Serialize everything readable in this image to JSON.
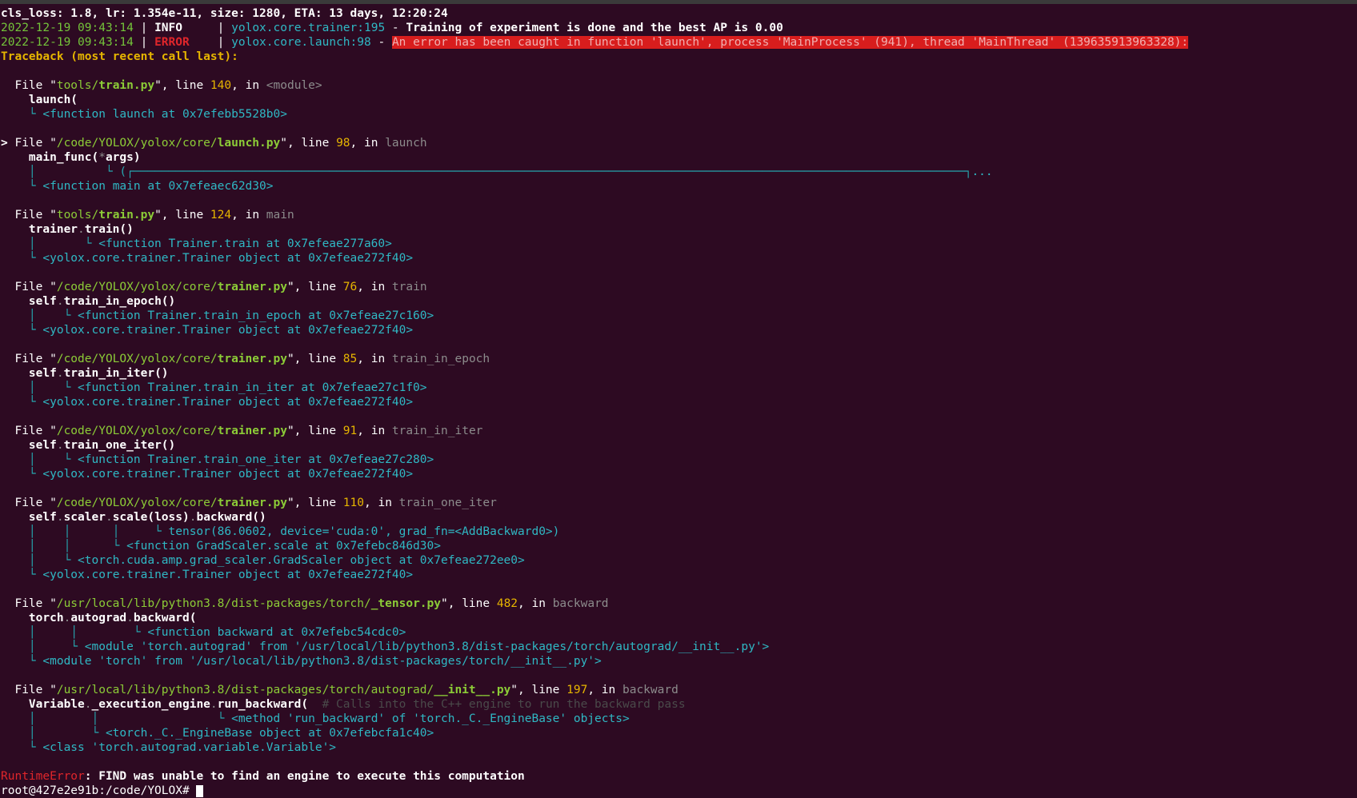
{
  "terminal": {
    "lines": [
      [
        {
          "t": "cls_loss: 1.8, lr: 1.354e-11, size: 1280, ETA: 13 days, 12:20:24",
          "c": "w b"
        }
      ],
      [
        {
          "t": "2022-12-19 09:43:14",
          "c": "ok"
        },
        {
          "t": " | ",
          "c": "w"
        },
        {
          "t": "INFO    ",
          "c": "w b"
        },
        {
          "t": " | ",
          "c": "w"
        },
        {
          "t": "yolox.core.trainer",
          "c": "c"
        },
        {
          "t": ":195",
          "c": "c"
        },
        {
          "t": " - ",
          "c": "w"
        },
        {
          "t": "Training of experiment is done and the best AP is 0.00",
          "c": "w b"
        }
      ],
      [
        {
          "t": "2022-12-19 09:43:14",
          "c": "ok"
        },
        {
          "t": " | ",
          "c": "w"
        },
        {
          "t": "ERROR   ",
          "c": "r b"
        },
        {
          "t": " | ",
          "c": "w"
        },
        {
          "t": "yolox.core.launch",
          "c": "c"
        },
        {
          "t": ":98",
          "c": "c"
        },
        {
          "t": " - ",
          "c": "w"
        },
        {
          "t": "An error has been caught in function 'launch', process 'MainProcess' (941), thread 'MainThread' (139635913963328):",
          "c": "hl"
        }
      ],
      [
        {
          "t": "Traceback (most recent call last):",
          "c": "y b"
        }
      ],
      [],
      [
        {
          "t": "  File \"",
          "c": "w"
        },
        {
          "t": "tools/",
          "c": "g"
        },
        {
          "t": "train.py",
          "c": "g b"
        },
        {
          "t": "\", line ",
          "c": "w"
        },
        {
          "t": "140",
          "c": "y"
        },
        {
          "t": ", in ",
          "c": "w"
        },
        {
          "t": "<module>",
          "c": "d"
        }
      ],
      [
        {
          "t": "    launch(",
          "c": "w b"
        }
      ],
      [
        {
          "t": "    └ ",
          "c": "tr"
        },
        {
          "t": "<function launch at 0x7efebb5528b0>",
          "c": "c"
        }
      ],
      [],
      [
        {
          "t": "> ",
          "c": "w b"
        },
        {
          "t": "File \"",
          "c": "w"
        },
        {
          "t": "/code/YOLOX/yolox/core/",
          "c": "g"
        },
        {
          "t": "launch.py",
          "c": "g b"
        },
        {
          "t": "\", line ",
          "c": "w"
        },
        {
          "t": "98",
          "c": "y"
        },
        {
          "t": ", in ",
          "c": "w"
        },
        {
          "t": "launch",
          "c": "d"
        }
      ],
      [
        {
          "t": "    main_func(",
          "c": "w b"
        },
        {
          "t": "*",
          "c": "d"
        },
        {
          "t": "args)",
          "c": "w b"
        }
      ],
      [
        {
          "t": "    │          └ (",
          "c": "tr"
        },
        {
          "t": "┌───────────────────────────────────────────────────────────────────────────────────────────────────────────────────────┐",
          "c": "tr"
        },
        {
          "t": "...",
          "c": "c"
        }
      ],
      [
        {
          "t": "    └ ",
          "c": "tr"
        },
        {
          "t": "<function main at 0x7efeaec62d30>",
          "c": "c"
        }
      ],
      [],
      [
        {
          "t": "  File \"",
          "c": "w"
        },
        {
          "t": "tools/",
          "c": "g"
        },
        {
          "t": "train.py",
          "c": "g b"
        },
        {
          "t": "\", line ",
          "c": "w"
        },
        {
          "t": "124",
          "c": "y"
        },
        {
          "t": ", in ",
          "c": "w"
        },
        {
          "t": "main",
          "c": "d"
        }
      ],
      [
        {
          "t": "    trainer",
          "c": "w b"
        },
        {
          "t": ".",
          "c": "d"
        },
        {
          "t": "train()",
          "c": "w b"
        }
      ],
      [
        {
          "t": "    │       └ ",
          "c": "tr"
        },
        {
          "t": "<function Trainer.train at 0x7efeae277a60>",
          "c": "c"
        }
      ],
      [
        {
          "t": "    └ ",
          "c": "tr"
        },
        {
          "t": "<yolox.core.trainer.Trainer object at 0x7efeae272f40>",
          "c": "c"
        }
      ],
      [],
      [
        {
          "t": "  File \"",
          "c": "w"
        },
        {
          "t": "/code/YOLOX/yolox/core/",
          "c": "g"
        },
        {
          "t": "trainer.py",
          "c": "g b"
        },
        {
          "t": "\", line ",
          "c": "w"
        },
        {
          "t": "76",
          "c": "y"
        },
        {
          "t": ", in ",
          "c": "w"
        },
        {
          "t": "train",
          "c": "d"
        }
      ],
      [
        {
          "t": "    self",
          "c": "w b"
        },
        {
          "t": ".",
          "c": "d"
        },
        {
          "t": "train_in_epoch()",
          "c": "w b"
        }
      ],
      [
        {
          "t": "    │    └ ",
          "c": "tr"
        },
        {
          "t": "<function Trainer.train_in_epoch at 0x7efeae27c160>",
          "c": "c"
        }
      ],
      [
        {
          "t": "    └ ",
          "c": "tr"
        },
        {
          "t": "<yolox.core.trainer.Trainer object at 0x7efeae272f40>",
          "c": "c"
        }
      ],
      [],
      [
        {
          "t": "  File \"",
          "c": "w"
        },
        {
          "t": "/code/YOLOX/yolox/core/",
          "c": "g"
        },
        {
          "t": "trainer.py",
          "c": "g b"
        },
        {
          "t": "\", line ",
          "c": "w"
        },
        {
          "t": "85",
          "c": "y"
        },
        {
          "t": ", in ",
          "c": "w"
        },
        {
          "t": "train_in_epoch",
          "c": "d"
        }
      ],
      [
        {
          "t": "    self",
          "c": "w b"
        },
        {
          "t": ".",
          "c": "d"
        },
        {
          "t": "train_in_iter()",
          "c": "w b"
        }
      ],
      [
        {
          "t": "    │    └ ",
          "c": "tr"
        },
        {
          "t": "<function Trainer.train_in_iter at 0x7efeae27c1f0>",
          "c": "c"
        }
      ],
      [
        {
          "t": "    └ ",
          "c": "tr"
        },
        {
          "t": "<yolox.core.trainer.Trainer object at 0x7efeae272f40>",
          "c": "c"
        }
      ],
      [],
      [
        {
          "t": "  File \"",
          "c": "w"
        },
        {
          "t": "/code/YOLOX/yolox/core/",
          "c": "g"
        },
        {
          "t": "trainer.py",
          "c": "g b"
        },
        {
          "t": "\", line ",
          "c": "w"
        },
        {
          "t": "91",
          "c": "y"
        },
        {
          "t": ", in ",
          "c": "w"
        },
        {
          "t": "train_in_iter",
          "c": "d"
        }
      ],
      [
        {
          "t": "    self",
          "c": "w b"
        },
        {
          "t": ".",
          "c": "d"
        },
        {
          "t": "train_one_iter()",
          "c": "w b"
        }
      ],
      [
        {
          "t": "    │    └ ",
          "c": "tr"
        },
        {
          "t": "<function Trainer.train_one_iter at 0x7efeae27c280>",
          "c": "c"
        }
      ],
      [
        {
          "t": "    └ ",
          "c": "tr"
        },
        {
          "t": "<yolox.core.trainer.Trainer object at 0x7efeae272f40>",
          "c": "c"
        }
      ],
      [],
      [
        {
          "t": "  File \"",
          "c": "w"
        },
        {
          "t": "/code/YOLOX/yolox/core/",
          "c": "g"
        },
        {
          "t": "trainer.py",
          "c": "g b"
        },
        {
          "t": "\", line ",
          "c": "w"
        },
        {
          "t": "110",
          "c": "y"
        },
        {
          "t": ", in ",
          "c": "w"
        },
        {
          "t": "train_one_iter",
          "c": "d"
        }
      ],
      [
        {
          "t": "    self",
          "c": "w b"
        },
        {
          "t": ".",
          "c": "d"
        },
        {
          "t": "scaler",
          "c": "w b"
        },
        {
          "t": ".",
          "c": "d"
        },
        {
          "t": "scale(loss)",
          "c": "w b"
        },
        {
          "t": ".",
          "c": "d"
        },
        {
          "t": "backward()",
          "c": "w b"
        }
      ],
      [
        {
          "t": "    │    │      │     └ ",
          "c": "tr"
        },
        {
          "t": "tensor(86.0602, device='cuda:0', grad_fn=<AddBackward0>)",
          "c": "c"
        }
      ],
      [
        {
          "t": "    │    │      └ ",
          "c": "tr"
        },
        {
          "t": "<function GradScaler.scale at 0x7efebc846d30>",
          "c": "c"
        }
      ],
      [
        {
          "t": "    │    └ ",
          "c": "tr"
        },
        {
          "t": "<torch.cuda.amp.grad_scaler.GradScaler object at 0x7efeae272ee0>",
          "c": "c"
        }
      ],
      [
        {
          "t": "    └ ",
          "c": "tr"
        },
        {
          "t": "<yolox.core.trainer.Trainer object at 0x7efeae272f40>",
          "c": "c"
        }
      ],
      [],
      [
        {
          "t": "  File \"",
          "c": "w"
        },
        {
          "t": "/usr/local/lib/python3.8/dist-packages/torch/",
          "c": "g"
        },
        {
          "t": "_tensor.py",
          "c": "g b"
        },
        {
          "t": "\", line ",
          "c": "w"
        },
        {
          "t": "482",
          "c": "y"
        },
        {
          "t": ", in ",
          "c": "w"
        },
        {
          "t": "backward",
          "c": "d"
        }
      ],
      [
        {
          "t": "    torch",
          "c": "w b"
        },
        {
          "t": ".",
          "c": "d"
        },
        {
          "t": "autograd",
          "c": "w b"
        },
        {
          "t": ".",
          "c": "d"
        },
        {
          "t": "backward(",
          "c": "w b"
        }
      ],
      [
        {
          "t": "    │     │        └ ",
          "c": "tr"
        },
        {
          "t": "<function backward at 0x7efebc54cdc0>",
          "c": "c"
        }
      ],
      [
        {
          "t": "    │     └ ",
          "c": "tr"
        },
        {
          "t": "<module 'torch.autograd' from '/usr/local/lib/python3.8/dist-packages/torch/autograd/__init__.py'>",
          "c": "c"
        }
      ],
      [
        {
          "t": "    └ ",
          "c": "tr"
        },
        {
          "t": "<module 'torch' from '/usr/local/lib/python3.8/dist-packages/torch/__init__.py'>",
          "c": "c"
        }
      ],
      [],
      [
        {
          "t": "  File \"",
          "c": "w"
        },
        {
          "t": "/usr/local/lib/python3.8/dist-packages/torch/autograd/",
          "c": "g"
        },
        {
          "t": "__init__.py",
          "c": "g b"
        },
        {
          "t": "\", line ",
          "c": "w"
        },
        {
          "t": "197",
          "c": "y"
        },
        {
          "t": ", in ",
          "c": "w"
        },
        {
          "t": "backward",
          "c": "d"
        }
      ],
      [
        {
          "t": "    Variable",
          "c": "w b"
        },
        {
          "t": ".",
          "c": "d"
        },
        {
          "t": "_execution_engine",
          "c": "w b"
        },
        {
          "t": ".",
          "c": "d"
        },
        {
          "t": "run_backward(",
          "c": "w b"
        },
        {
          "t": "  # Calls into the C++ engine to run the backward pass",
          "c": "cm"
        }
      ],
      [
        {
          "t": "    │        │                 └ ",
          "c": "tr"
        },
        {
          "t": "<method 'run_backward' of 'torch._C._EngineBase' objects>",
          "c": "c"
        }
      ],
      [
        {
          "t": "    │        └ ",
          "c": "tr"
        },
        {
          "t": "<torch._C._EngineBase object at 0x7efebcfa1c40>",
          "c": "c"
        }
      ],
      [
        {
          "t": "    └ ",
          "c": "tr"
        },
        {
          "t": "<class 'torch.autograd.variable.Variable'>",
          "c": "c"
        }
      ],
      [],
      [
        {
          "t": "RuntimeError",
          "c": "r"
        },
        {
          "t": ": FIND was unable to find an engine to execute this computation",
          "c": "w b"
        }
      ]
    ],
    "prompt": "root@427e2e91b:/code/YOLOX# "
  },
  "colors": {
    "background": "#2d0a22",
    "highlight_bg": "#d81d1d",
    "highlight_fg": "#f0b0b0",
    "comment": "#4a4a4a"
  }
}
